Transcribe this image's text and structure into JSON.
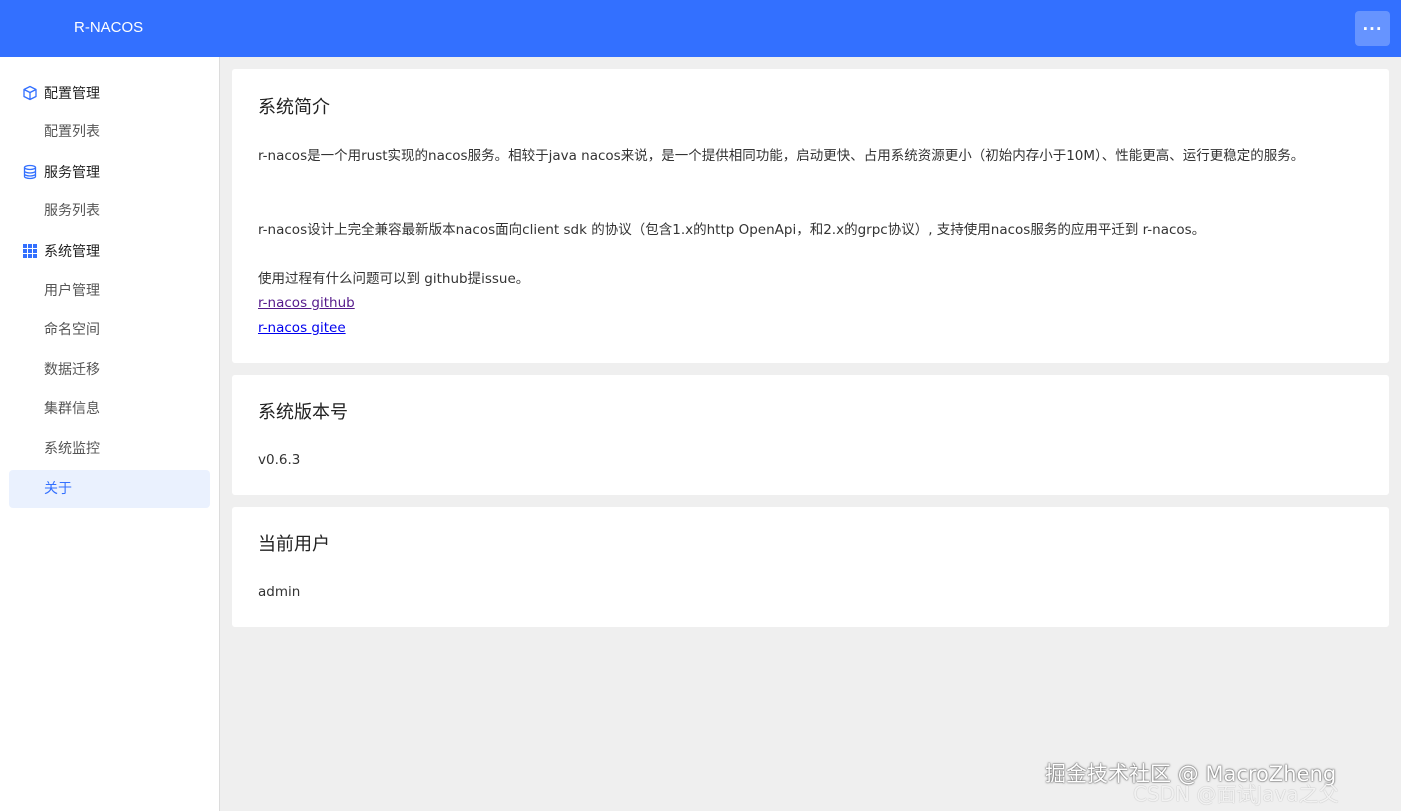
{
  "header": {
    "app_title": "R-NACOS",
    "more_icon": "···"
  },
  "sidebar": {
    "config_group": {
      "label": "配置管理",
      "icon": "cube-icon"
    },
    "config_list": "配置列表",
    "service_group": {
      "label": "服务管理",
      "icon": "database-icon"
    },
    "service_list": "服务列表",
    "system_group": {
      "label": "系统管理",
      "icon": "grid-icon"
    },
    "user_mgmt": "用户管理",
    "namespace": "命名空间",
    "data_migration": "数据迁移",
    "cluster_info": "集群信息",
    "system_monitor": "系统监控",
    "about": "关于"
  },
  "intro": {
    "title": "系统简介",
    "paragraph1": "r-nacos是一个用rust实现的nacos服务。相较于java nacos来说，是一个提供相同功能，启动更快、占用系统资源更小（初始内存小于10M）、性能更高、运行更稳定的服务。",
    "paragraph2": "r-nacos设计上完全兼容最新版本nacos面向client sdk 的协议（包含1.x的http OpenApi，和2.x的grpc协议）, 支持使用nacos服务的应用平迁到 r-nacos。",
    "paragraph3": "使用过程有什么问题可以到 github提issue。",
    "link_github": "r-nacos github",
    "link_gitee": "r-nacos gitee"
  },
  "version": {
    "title": "系统版本号",
    "value": "v0.6.3"
  },
  "current_user": {
    "title": "当前用户",
    "value": "admin"
  },
  "watermark": {
    "line1": "掘金技术社区 @ MacroZheng",
    "line2": "CSDN @面试Java之父"
  },
  "colors": {
    "accent": "#3370ff",
    "active_bg": "#eaf1fe"
  }
}
